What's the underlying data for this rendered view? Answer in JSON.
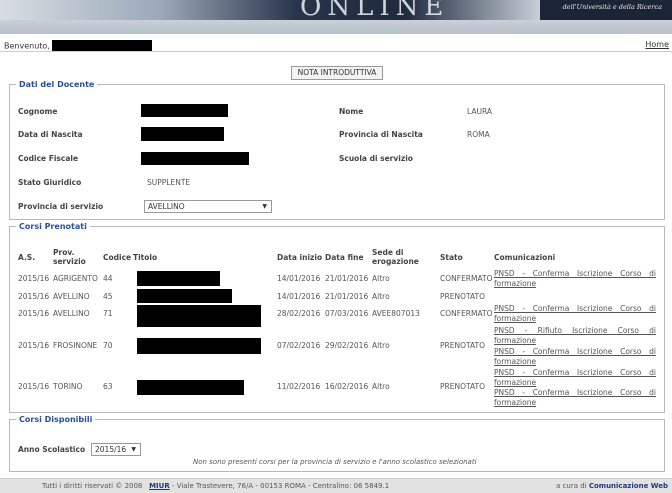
{
  "banner": {
    "logo_text": "ONLINE",
    "tagline": "dell'Università e della Ricerca"
  },
  "header": {
    "welcome_label": "Benvenuto,",
    "home_link": "Home"
  },
  "nota_button": "NOTA INTRODUTTIVA",
  "docente": {
    "legend": "Dati del Docente",
    "cognome_label": "Cognome",
    "data_nascita_label": "Data di Nascita",
    "codice_fiscale_label": "Codice Fiscale",
    "stato_giuridico_label": "Stato Giuridico",
    "stato_giuridico_value": "SUPPLENTE",
    "provincia_servizio_label": "Provincia di servizio",
    "provincia_servizio_value": "AVELLINO",
    "nome_label": "Nome",
    "nome_value": "LAURA",
    "provincia_nascita_label": "Provincia di Nascita",
    "provincia_nascita_value": "ROMA",
    "scuola_servizio_label": "Scuola di servizio"
  },
  "prenotati": {
    "legend": "Corsi Prenotati",
    "columns": {
      "as": "A.S.",
      "prov": "Prov. servizio",
      "codice": "Codice",
      "titolo": "Titolo",
      "data_inizio": "Data inizio",
      "data_fine": "Data fine",
      "sede": "Sede di erogazione",
      "stato": "Stato",
      "comunicazioni": "Comunicazioni"
    },
    "rows": [
      {
        "as": "2015/16",
        "prov": "AGRIGENTO",
        "codice": "44",
        "data_inizio": "14/01/2016",
        "data_fine": "21/01/2016",
        "sede": "Altro",
        "stato": "CONFERMATO",
        "comunicazioni": [
          "PNSD - Conferma Iscrizione Corso di formazione"
        ]
      },
      {
        "as": "2015/16",
        "prov": "AVELLINO",
        "codice": "45",
        "data_inizio": "14/01/2016",
        "data_fine": "21/01/2016",
        "sede": "Altro",
        "stato": "PRENOTATO",
        "comunicazioni": []
      },
      {
        "as": "2015/16",
        "prov": "AVELLINO",
        "codice": "71",
        "data_inizio": "28/02/2016",
        "data_fine": "07/03/2016",
        "sede": "AVEE807013",
        "stato": "CONFERMATO",
        "comunicazioni": [
          "PNSD - Conferma Iscrizione Corso di formazione"
        ]
      },
      {
        "as": "2015/16",
        "prov": "FROSINONE",
        "codice": "70",
        "data_inizio": "07/02/2016",
        "data_fine": "29/02/2016",
        "sede": "Altro",
        "stato": "PRENOTATO",
        "comunicazioni": [
          "PNSD - Rifiuto Iscrizione Corso di formazione",
          "PNSD - Conferma Iscrizione Corso di formazione"
        ]
      },
      {
        "as": "2015/16",
        "prov": "TORINO",
        "codice": "63",
        "data_inizio": "11/02/2016",
        "data_fine": "16/02/2016",
        "sede": "Altro",
        "stato": "PRENOTATO",
        "comunicazioni": [
          "PNSD - Conferma Iscrizione Corso di formazione",
          "PNSD - Conferma Iscrizione Corso di formazione"
        ]
      }
    ]
  },
  "disponibili": {
    "legend": "Corsi Disponibili",
    "anno_label": "Anno Scolastico",
    "anno_value": "2015/16",
    "empty_message": "Non sono presenti corsi per la provincia di servizio e l'anno scolastico selezionati"
  },
  "footer": {
    "rights": "Tutti i diritti riservati © 2008",
    "miur": "MIUR",
    "address": " - Viale Trastevere, 76/A - 00153 ROMA - Centralino: 06 5849.1",
    "credit_prefix": "a cura di ",
    "credit_name": "Comunicazione Web"
  }
}
